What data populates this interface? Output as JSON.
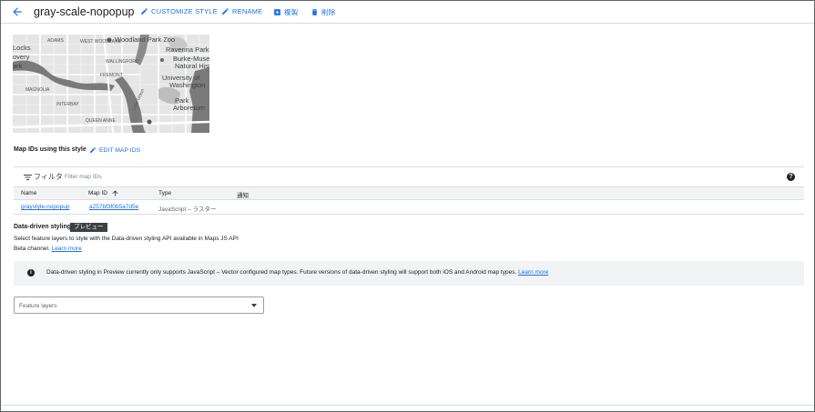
{
  "header": {
    "title": "gray-scale-nopopup",
    "actions": {
      "customize": "CUSTOMIZE STYLE",
      "rename": "RENAME",
      "duplicate": "複製",
      "delete": "削除"
    }
  },
  "map_preview": {
    "labels": [
      "Woodland Park Zoo",
      "Ravenna Park",
      "Burke-Museum of",
      "Natural Hist",
      "University of",
      "Washington",
      "Park",
      "Arboretum",
      "MAGNOLIA",
      "INTERBAY",
      "QUEEN ANNE",
      "WALLINGFORD",
      "FREMONT",
      "WEST WOODLAND",
      "ADAMS",
      "Locks",
      "overy",
      "ark",
      "Lake Union"
    ]
  },
  "map_ids": {
    "section_label": "Map IDs using this style",
    "edit_label": "EDIT MAP IDS",
    "filter_label": "フィルタ",
    "filter_placeholder": "Filter map IDs",
    "help_glyph": "?",
    "columns": {
      "name": "Name",
      "map_id": "Map ID",
      "type": "Type",
      "notify": "通知"
    },
    "rows": [
      {
        "name": "graystyle-nopopup",
        "map_id": "a257bf3f0b5a7d5e",
        "type": "JavaScript – ラスター",
        "notify": ""
      }
    ]
  },
  "data_driven": {
    "title": "Data-driven styling",
    "badge": "プレビュー",
    "desc_line1": "Select feature layers to style with the Data-driven styling API available in Maps JS API",
    "desc_line2": "Beta channel.",
    "learn_more": "Learn more",
    "info_glyph": "i",
    "info_text": "Data-driven styling in Preview currently only supports JavaScript – Vector configured map types. Future versions of data-driven styling will support both iOS and Android map types.",
    "info_learn_more": "Learn more",
    "feature_layers_placeholder": "Feature layers"
  }
}
